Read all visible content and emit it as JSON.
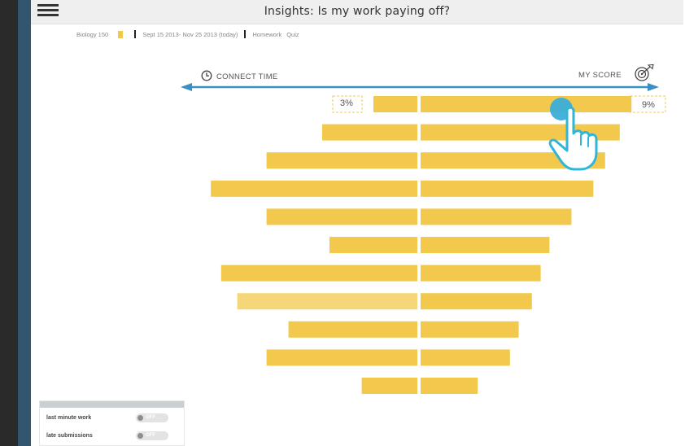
{
  "header": {
    "title": "Insights: Is my work paying off?",
    "menu_icon": "hamburger-menu-icon"
  },
  "filters": {
    "course": "Biology 150",
    "course_color": "#f2c94c",
    "date_range": "Sept 15 2013- Nov 25 2013 (today)",
    "types": [
      "Homework",
      "Quiz"
    ]
  },
  "axis": {
    "left_label": "CONNECT TIME",
    "left_icon": "clock-icon",
    "right_label": "MY SCORE",
    "right_icon": "target-icon",
    "arrow_color": "#3b8fc2"
  },
  "highlight": {
    "left_value": "3%",
    "right_value": "9%"
  },
  "chart_data": {
    "type": "bar",
    "orientation": "horizontal-diverging",
    "left_series": {
      "name": "CONNECT TIME",
      "values": [
        3,
        6.5,
        10.3,
        14.1,
        10.3,
        6,
        13.4,
        12.3,
        8.8,
        10.3,
        3.8
      ]
    },
    "right_series": {
      "name": "MY SCORE",
      "values": [
        14.4,
        13.6,
        12.6,
        11.8,
        10.3,
        8.8,
        8.2,
        7.6,
        6.7,
        6.1,
        3.9
      ]
    },
    "value_unit": "%",
    "bar_color": "#f2c94c",
    "bar_color_light": "#f5d77a",
    "highlighted_index": 0,
    "light_left_index": 7
  },
  "gesture": {
    "pointer_color": "#3aaed8",
    "hand_icon": "tap-hand-icon"
  },
  "options": {
    "rows": [
      {
        "label": "last minute work",
        "state": "OFF"
      },
      {
        "label": "late submissions",
        "state": "OFF"
      }
    ]
  }
}
